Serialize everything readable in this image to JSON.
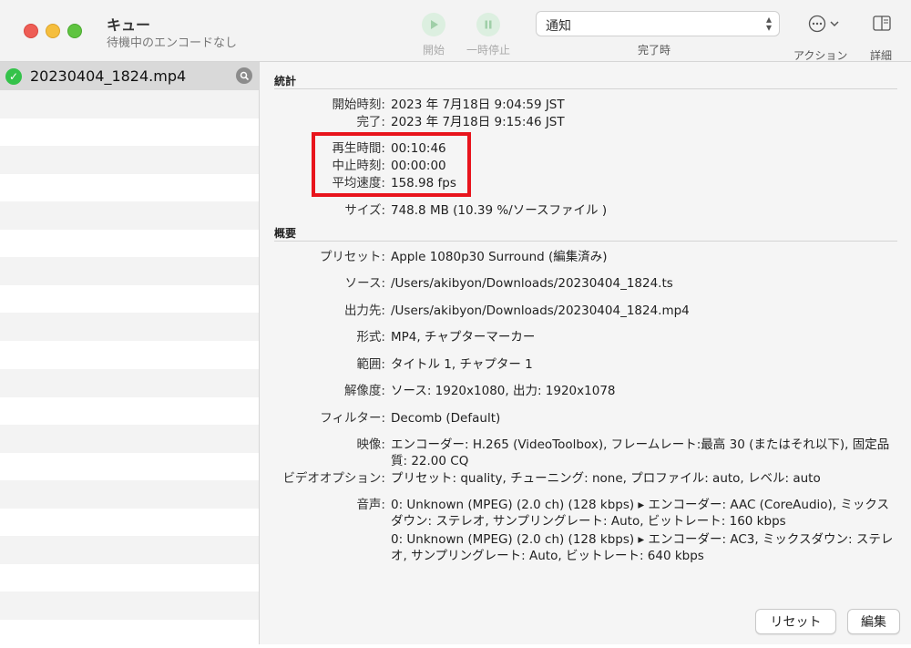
{
  "window": {
    "title": "キュー",
    "subtitle": "待機中のエンコードなし"
  },
  "toolbar": {
    "start_label": "開始",
    "pause_label": "一時停止",
    "notify_value": "通知",
    "notify_label": "完了時",
    "action_label": "アクション",
    "detail_label": "詳細"
  },
  "queue": {
    "items": [
      {
        "name": "20230404_1824.mp4",
        "status": "done"
      }
    ]
  },
  "stats": {
    "heading": "統計",
    "rows": [
      {
        "label": "開始時刻:",
        "value": "2023 年 7月18日 9:04:59 JST"
      },
      {
        "label": "完了:",
        "value": "2023 年 7月18日 9:15:46 JST"
      },
      {
        "label": "再生時間:",
        "value": "00:10:46"
      },
      {
        "label": "中止時刻:",
        "value": "00:00:00"
      },
      {
        "label": "平均速度:",
        "value": "158.98 fps"
      },
      {
        "label": "サイズ:",
        "value": "748.8 MB (10.39 %/ソースファイル )"
      }
    ]
  },
  "summary": {
    "heading": "概要",
    "rows": [
      {
        "label": "プリセット:",
        "value": "Apple 1080p30 Surround (編集済み)"
      },
      {
        "label": "ソース:",
        "value": "/Users/akibyon/Downloads/20230404_1824.ts"
      },
      {
        "label": "出力先:",
        "value": "/Users/akibyon/Downloads/20230404_1824.mp4"
      },
      {
        "label": "形式:",
        "value": "MP4, チャプターマーカー"
      },
      {
        "label": "範囲:",
        "value": "タイトル 1, チャプター 1"
      },
      {
        "label": "解像度:",
        "value": "ソース: 1920x1080, 出力: 1920x1078"
      },
      {
        "label": "フィルター:",
        "value": "Decomb (Default)"
      },
      {
        "label": "映像:",
        "value": "エンコーダー: H.265 (VideoToolbox), フレームレート:最高 30 (またはそれ以下), 固定品質: 22.00 CQ"
      },
      {
        "label": "ビデオオプション:",
        "value": "プリセット: quality, チューニング: none, プロファイル: auto, レベル: auto"
      },
      {
        "label": "音声:",
        "value": "0: Unknown (MPEG) (2.0 ch) (128 kbps) ▸ エンコーダー: AAC (CoreAudio), ミックスダウン: ステレオ, サンプリングレート: Auto, ビットレート: 160 kbps"
      },
      {
        "label": "",
        "value": "0: Unknown (MPEG) (2.0 ch) (128 kbps) ▸ エンコーダー: AC3, ミックスダウン: ステレオ, サンプリングレート: Auto, ビットレート: 640 kbps"
      }
    ]
  },
  "buttons": {
    "reset_label": "リセット",
    "edit_label": "編集"
  },
  "colors": {
    "highlight": "#e8141c",
    "done_check": "#34c24a"
  }
}
